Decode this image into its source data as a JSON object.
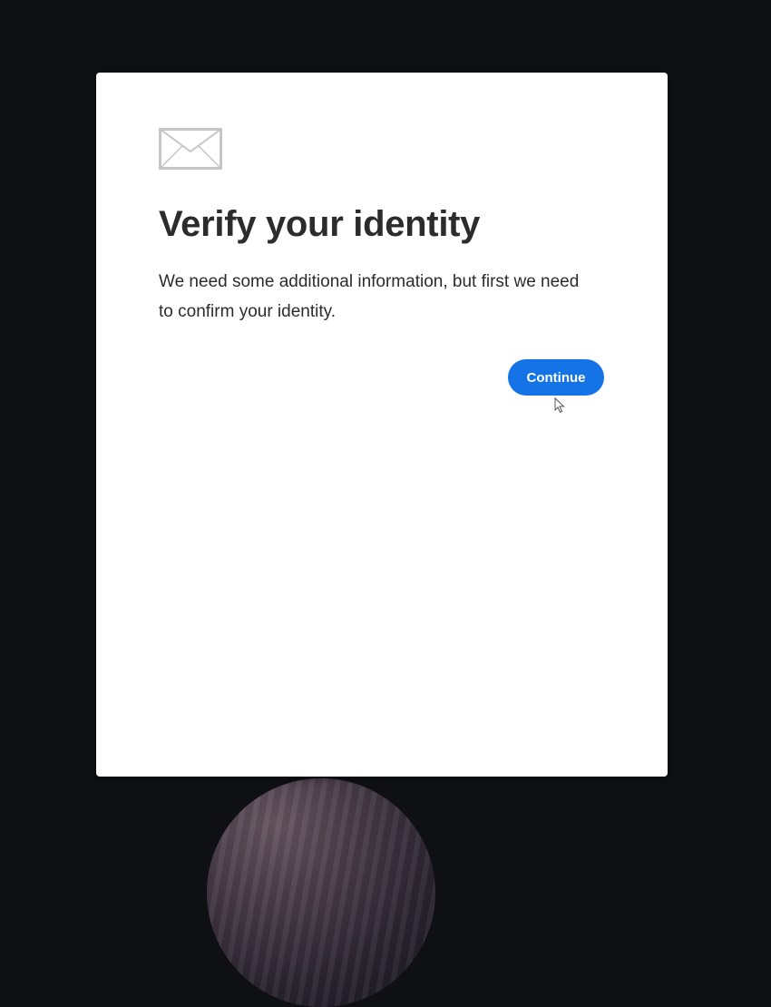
{
  "dialog": {
    "icon": "mail-icon",
    "title": "Verify your identity",
    "message": "We need some additional information, but first we need to confirm your identity.",
    "continue_label": "Continue"
  },
  "colors": {
    "backdrop": "#0f1014",
    "card": "#ffffff",
    "accent": "#1473e6",
    "text": "#2c2c2c",
    "icon_stroke": "#c6c6c6"
  },
  "cursor": {
    "icon": "mouse-pointer-icon"
  }
}
